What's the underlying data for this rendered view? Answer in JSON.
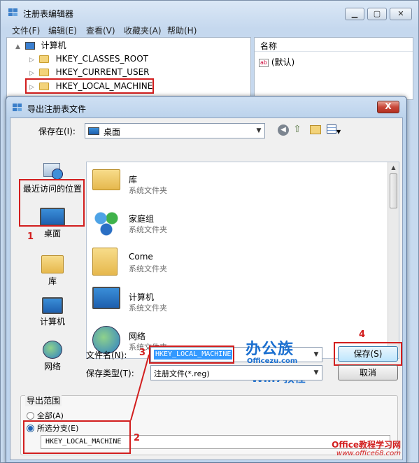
{
  "regedit": {
    "title": "注册表编辑器",
    "menu": [
      "文件(F)",
      "编辑(E)",
      "查看(V)",
      "收藏夹(A)",
      "帮助(H)"
    ],
    "tree_root": "计算机",
    "tree_items": [
      "HKEY_CLASSES_ROOT",
      "HKEY_CURRENT_USER",
      "HKEY_LOCAL_MACHINE"
    ],
    "list_header": "名称",
    "list_item": "(默认)"
  },
  "dialog": {
    "title": "导出注册表文件",
    "close_label": "X",
    "save_in_label": "保存在(I):",
    "save_in_value": "桌面",
    "places": [
      {
        "label": "最近访问的位置",
        "icon": "recent-places-icon"
      },
      {
        "label": "桌面",
        "icon": "desktop-icon"
      },
      {
        "label": "库",
        "icon": "libraries-icon"
      },
      {
        "label": "计算机",
        "icon": "computer-icon"
      },
      {
        "label": "网络",
        "icon": "network-icon"
      }
    ],
    "files": [
      {
        "name": "库",
        "type": "系统文件夹",
        "icon": "libraries-icon"
      },
      {
        "name": "家庭组",
        "type": "系统文件夹",
        "icon": "homegroup-icon"
      },
      {
        "name": "Come",
        "type": "系统文件夹",
        "icon": "user-folder-icon"
      },
      {
        "name": "计算机",
        "type": "系统文件夹",
        "icon": "computer-icon"
      },
      {
        "name": "网络",
        "type": "系统文件夹",
        "icon": "network-icon"
      }
    ],
    "filename_label": "文件名(N):",
    "filename_value": "HKEY_LOCAL_MACHINE",
    "filetype_label": "保存类型(T):",
    "filetype_value": "注册文件(*.reg)",
    "save_button": "保存(S)",
    "cancel_button": "取消",
    "export_range_label": "导出范围",
    "radio_all": "全部(A)",
    "radio_selected": "所选分支(E)",
    "branch_value": "HKEY_LOCAL_MACHINE"
  },
  "annotations": {
    "step1": "1",
    "step2": "2",
    "step3": "3",
    "step4": "4",
    "brand_top": "办公族",
    "brand_sub": "Officezu.com",
    "brand_win": "Win7教程",
    "watermark": "Office教程学习网",
    "watermark_url": "www.office68.com"
  },
  "colors": {
    "annotation_red": "#d21e1e",
    "dialog_frame": "#bfd5ee"
  }
}
